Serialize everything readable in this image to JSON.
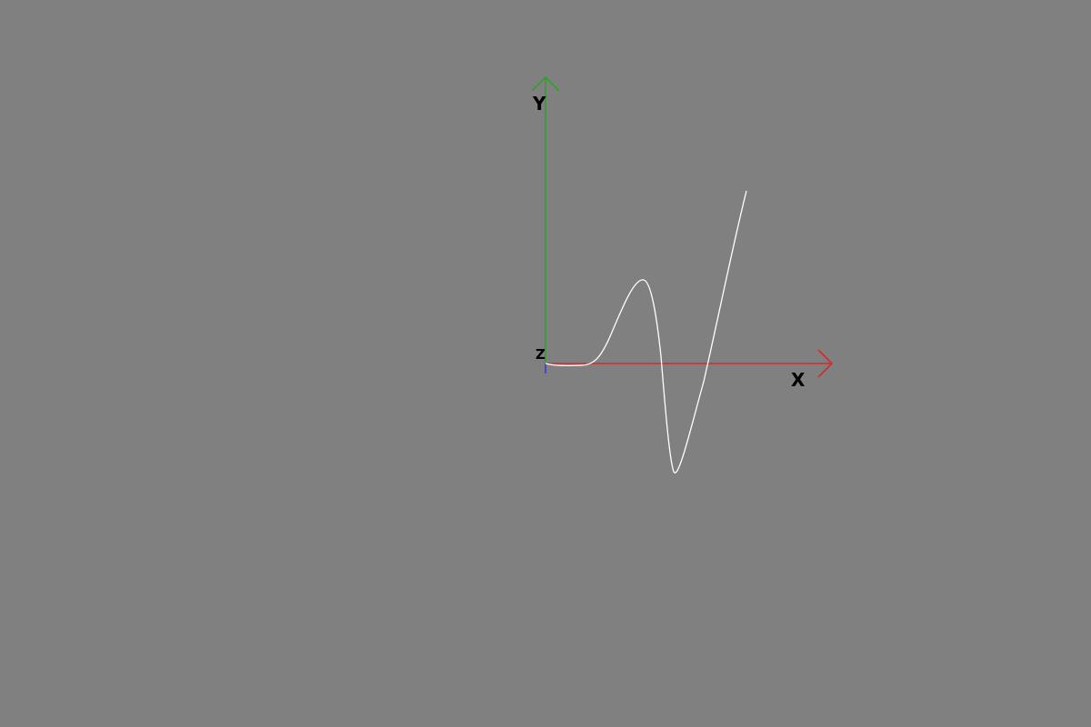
{
  "axes": {
    "x": {
      "label": "X",
      "color": "#d42a2a"
    },
    "y": {
      "label": "Y",
      "color": "#2fa02f"
    },
    "z": {
      "label": "Z",
      "color": "#3a3ad0"
    }
  },
  "curve": {
    "color": "#ffffff"
  }
}
